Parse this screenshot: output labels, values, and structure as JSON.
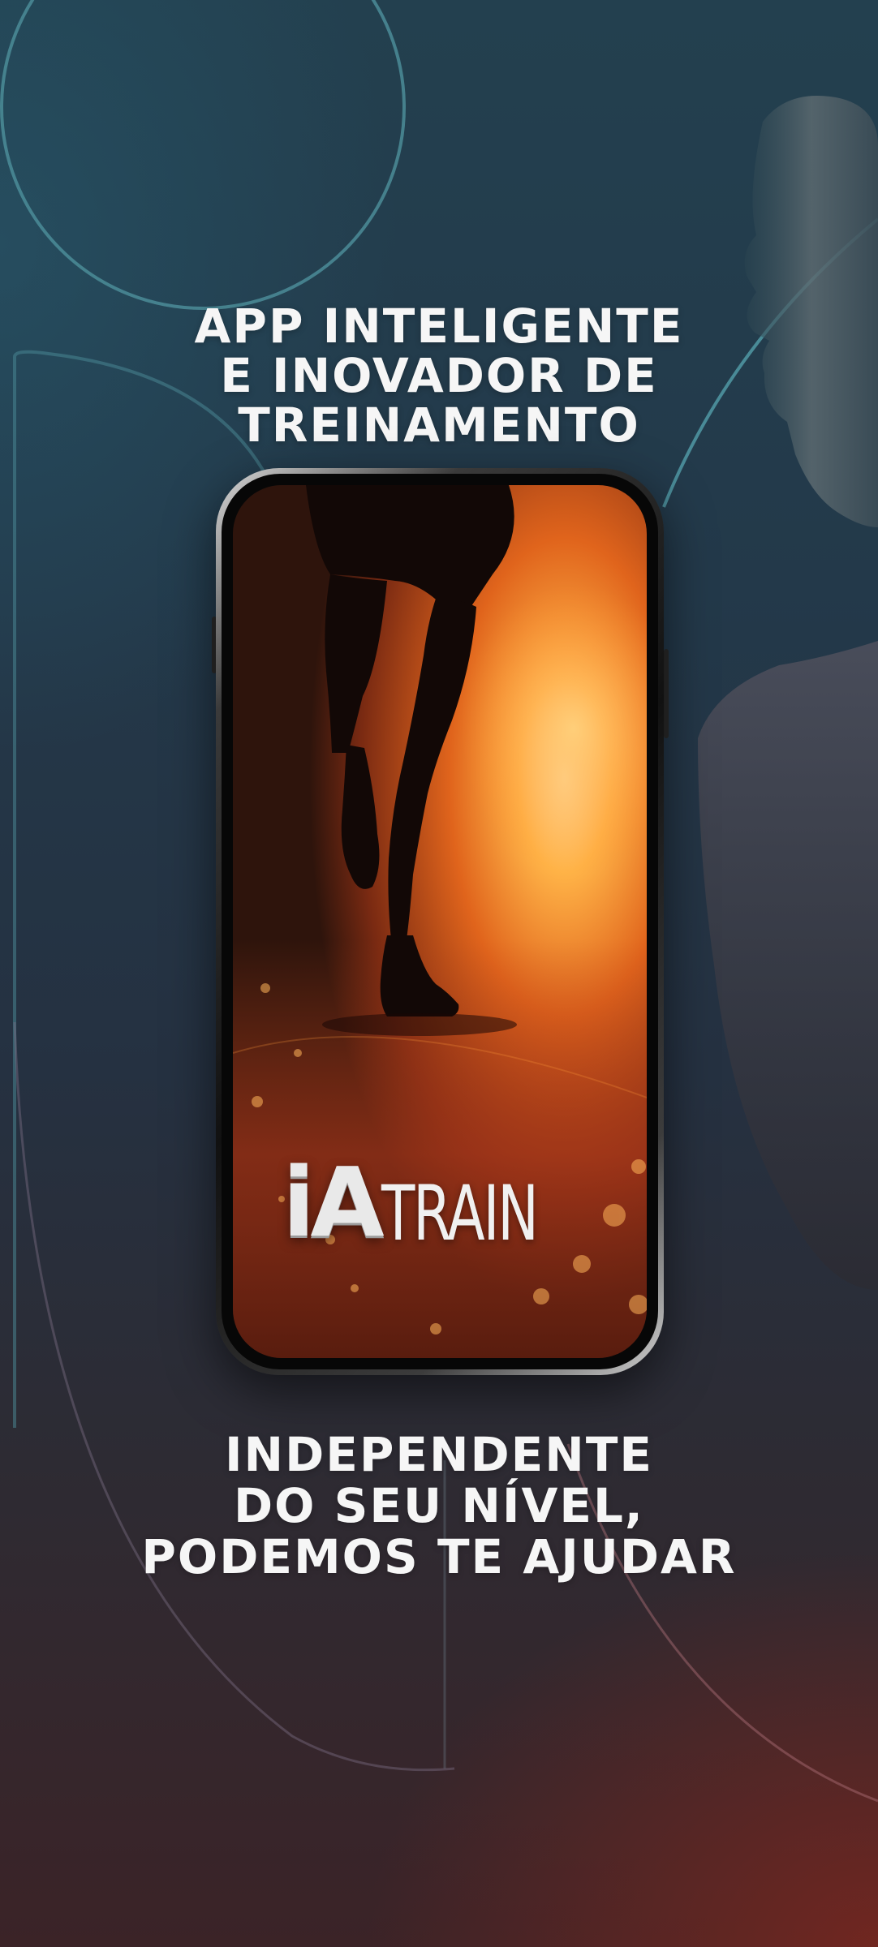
{
  "banner": {
    "top_headline": [
      "APP INTELIGENTE",
      "E INOVADOR DE",
      "TREINAMENTO"
    ],
    "bottom_headline": [
      "INDEPENDENTE",
      "DO SEU NÍVEL,",
      "PODEMOS TE AJUDAR"
    ]
  },
  "phone_screen": {
    "logo_prefix": "iA",
    "logo_suffix": "TRAIN",
    "scene": "runner-silhouette-at-sunset"
  },
  "colors": {
    "background_top": "#23404f",
    "background_bottom": "#3b2327",
    "accent_line": "#4b8c98",
    "screen_glow": "#ff9a2a",
    "headline": "#f6f6f6"
  }
}
